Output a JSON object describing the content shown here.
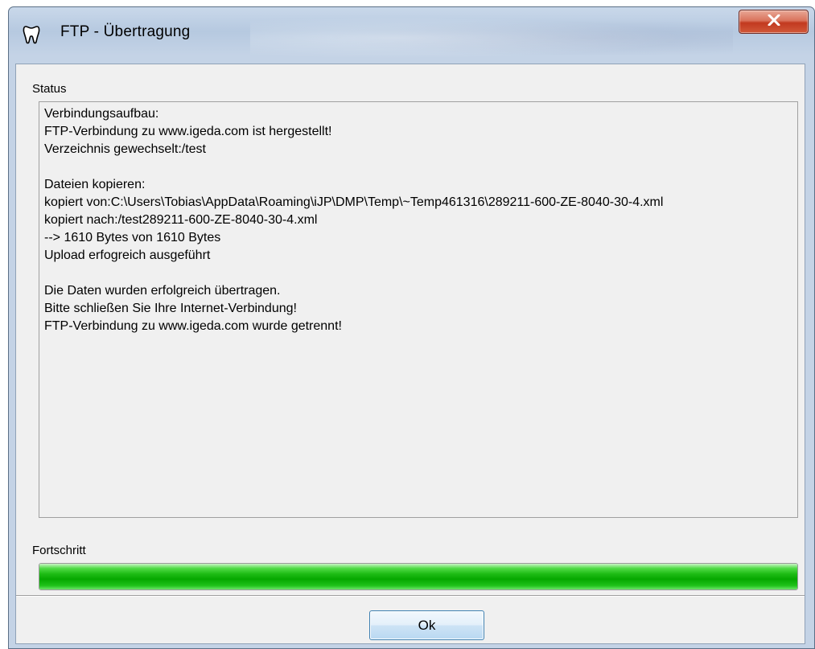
{
  "window": {
    "title": "FTP - Übertragung",
    "icon": "tooth-icon",
    "close_icon": "close-icon"
  },
  "status": {
    "label": "Status",
    "lines": [
      "Verbindungsaufbau:",
      "FTP-Verbindung zu www.igeda.com ist hergestellt!",
      "Verzeichnis gewechselt:/test",
      "",
      "Dateien kopieren:",
      "kopiert von:C:\\Users\\Tobias\\AppData\\Roaming\\iJP\\DMP\\Temp\\~Temp461316\\289211-600-ZE-8040-30-4.xml",
      "kopiert nach:/test289211-600-ZE-8040-30-4.xml",
      "--> 1610 Bytes von 1610 Bytes",
      "Upload erfogreich ausgeführt",
      "",
      "Die Daten wurden erfolgreich übertragen.",
      "Bitte schließen Sie Ihre Internet-Verbindung!",
      "FTP-Verbindung zu www.igeda.com wurde getrennt!"
    ]
  },
  "progress": {
    "label": "Fortschritt",
    "value_percent": 100,
    "color": "#06a800"
  },
  "buttons": {
    "ok_label": "Ok"
  }
}
